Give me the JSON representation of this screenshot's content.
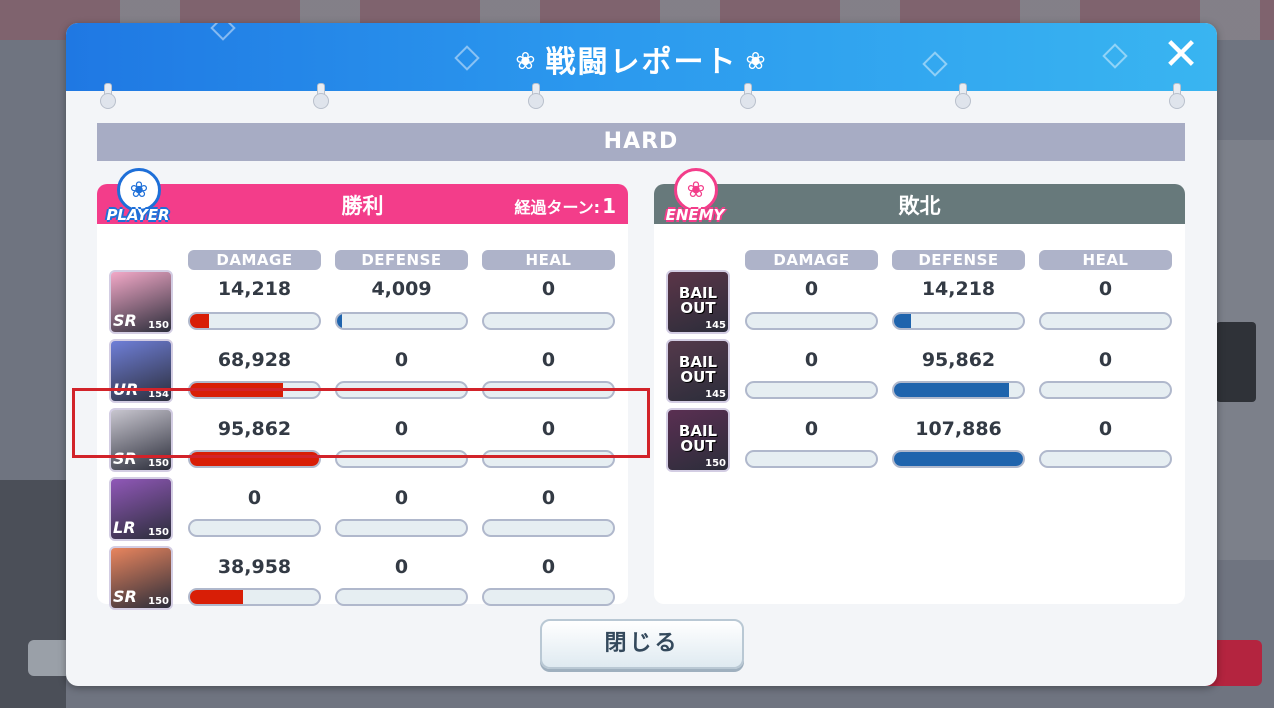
{
  "dialog": {
    "title": "戦闘レポート",
    "close_glyph": "✕",
    "difficulty": "HARD",
    "close_button_label": "閉じる"
  },
  "columns": [
    "DAMAGE",
    "DEFENSE",
    "HEAL"
  ],
  "player": {
    "badge": "PLAYER",
    "result": "勝利",
    "turn_label": "経過ターン:",
    "turn_count": "1",
    "units": [
      {
        "rarity": "SR",
        "level": "150",
        "damage": "14,218",
        "defense": "4,009",
        "heal": "0",
        "damage_ratio": 0.15,
        "defense_ratio": 0.04,
        "heal_ratio": 0,
        "color": "#f3a9c8"
      },
      {
        "rarity": "UR",
        "level": "154",
        "damage": "68,928",
        "defense": "0",
        "heal": "0",
        "damage_ratio": 0.72,
        "defense_ratio": 0,
        "heal_ratio": 0,
        "color": "#6f7fd8"
      },
      {
        "rarity": "SR",
        "level": "150",
        "damage": "95,862",
        "defense": "0",
        "heal": "0",
        "damage_ratio": 1.0,
        "defense_ratio": 0,
        "heal_ratio": 0,
        "color": "#c8c6cf"
      },
      {
        "rarity": "LR",
        "level": "150",
        "damage": "0",
        "defense": "0",
        "heal": "0",
        "damage_ratio": 0,
        "defense_ratio": 0,
        "heal_ratio": 0,
        "color": "#9058b8"
      },
      {
        "rarity": "SR",
        "level": "150",
        "damage": "38,958",
        "defense": "0",
        "heal": "0",
        "damage_ratio": 0.41,
        "defense_ratio": 0,
        "heal_ratio": 0,
        "color": "#e9855e"
      }
    ]
  },
  "enemy": {
    "badge": "ENEMY",
    "result": "敗北",
    "units": [
      {
        "name": "BAIL OUT",
        "level": "145",
        "damage": "0",
        "defense": "14,218",
        "heal": "0",
        "damage_ratio": 0,
        "defense_ratio": 0.13,
        "heal_ratio": 0,
        "color": "#5b3548"
      },
      {
        "name": "BAIL OUT",
        "level": "145",
        "damage": "0",
        "defense": "95,862",
        "heal": "0",
        "damage_ratio": 0,
        "defense_ratio": 0.89,
        "heal_ratio": 0,
        "color": "#54394b"
      },
      {
        "name": "BAIL OUT",
        "level": "150",
        "damage": "0",
        "defense": "107,886",
        "heal": "0",
        "damage_ratio": 0,
        "defense_ratio": 1.0,
        "heal_ratio": 0,
        "color": "#5a2f52"
      }
    ]
  },
  "colors": {
    "header_blue": "#2b98ee",
    "player_pink": "#f33d8a",
    "enemy_gray": "#67797b",
    "damage_red": "#d81e06",
    "defense_blue": "#1f64ad",
    "highlight_red": "#d2232a"
  }
}
